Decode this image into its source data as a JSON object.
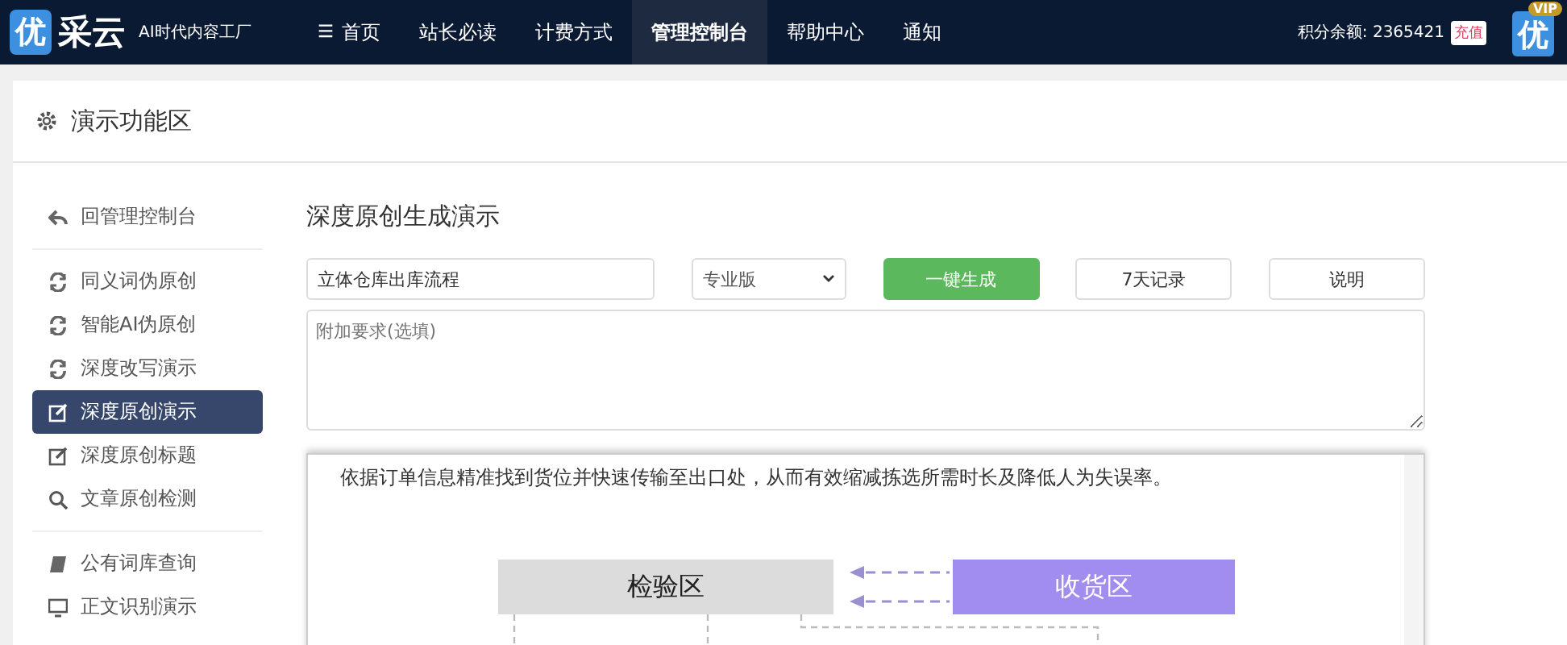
{
  "header": {
    "logo_mark": "优",
    "logo_text": "采云",
    "slogan": "AI时代内容工厂",
    "nav": [
      {
        "label": "首页",
        "selected": false
      },
      {
        "label": "站长必读",
        "selected": false
      },
      {
        "label": "计费方式",
        "selected": false
      },
      {
        "label": "管理控制台",
        "selected": true
      },
      {
        "label": "帮助中心",
        "selected": false
      },
      {
        "label": "通知",
        "selected": false
      }
    ],
    "balance": "积分余额: 2365421",
    "recharge": "充值",
    "vip_badge": "VIP",
    "avatar_text": "优"
  },
  "panel": {
    "title": "演示功能区"
  },
  "sidebar": {
    "groups": [
      [
        {
          "label": "回管理控制台",
          "selected": false
        }
      ],
      [
        {
          "label": "同义词伪原创",
          "selected": false
        },
        {
          "label": "智能AI伪原创",
          "selected": false
        },
        {
          "label": "深度改写演示",
          "selected": false
        },
        {
          "label": "深度原创演示",
          "selected": true
        },
        {
          "label": "深度原创标题",
          "selected": false
        },
        {
          "label": "文章原创检测",
          "selected": false
        }
      ],
      [
        {
          "label": "公有词库查询",
          "selected": false
        },
        {
          "label": "正文识别演示",
          "selected": false
        }
      ]
    ]
  },
  "main": {
    "title": "深度原创生成演示",
    "keyword": "立体仓库出库流程",
    "edition": "专业版",
    "buttons": [
      {
        "label": "一键生成",
        "kind": "primary"
      },
      {
        "label": "7天记录",
        "kind": "plain"
      },
      {
        "label": "说明",
        "kind": "plain"
      }
    ],
    "extra_placeholder": "附加要求(选填)",
    "result": {
      "paragraph": "依据订单信息精准找到货位并快速传输至出口处，从而有效缩减拣选所需时长及降低人为失误率。",
      "diagram": [
        {
          "label": "检验区",
          "kind": "grey"
        },
        {
          "label": "收货区",
          "kind": "purple"
        }
      ]
    }
  }
}
